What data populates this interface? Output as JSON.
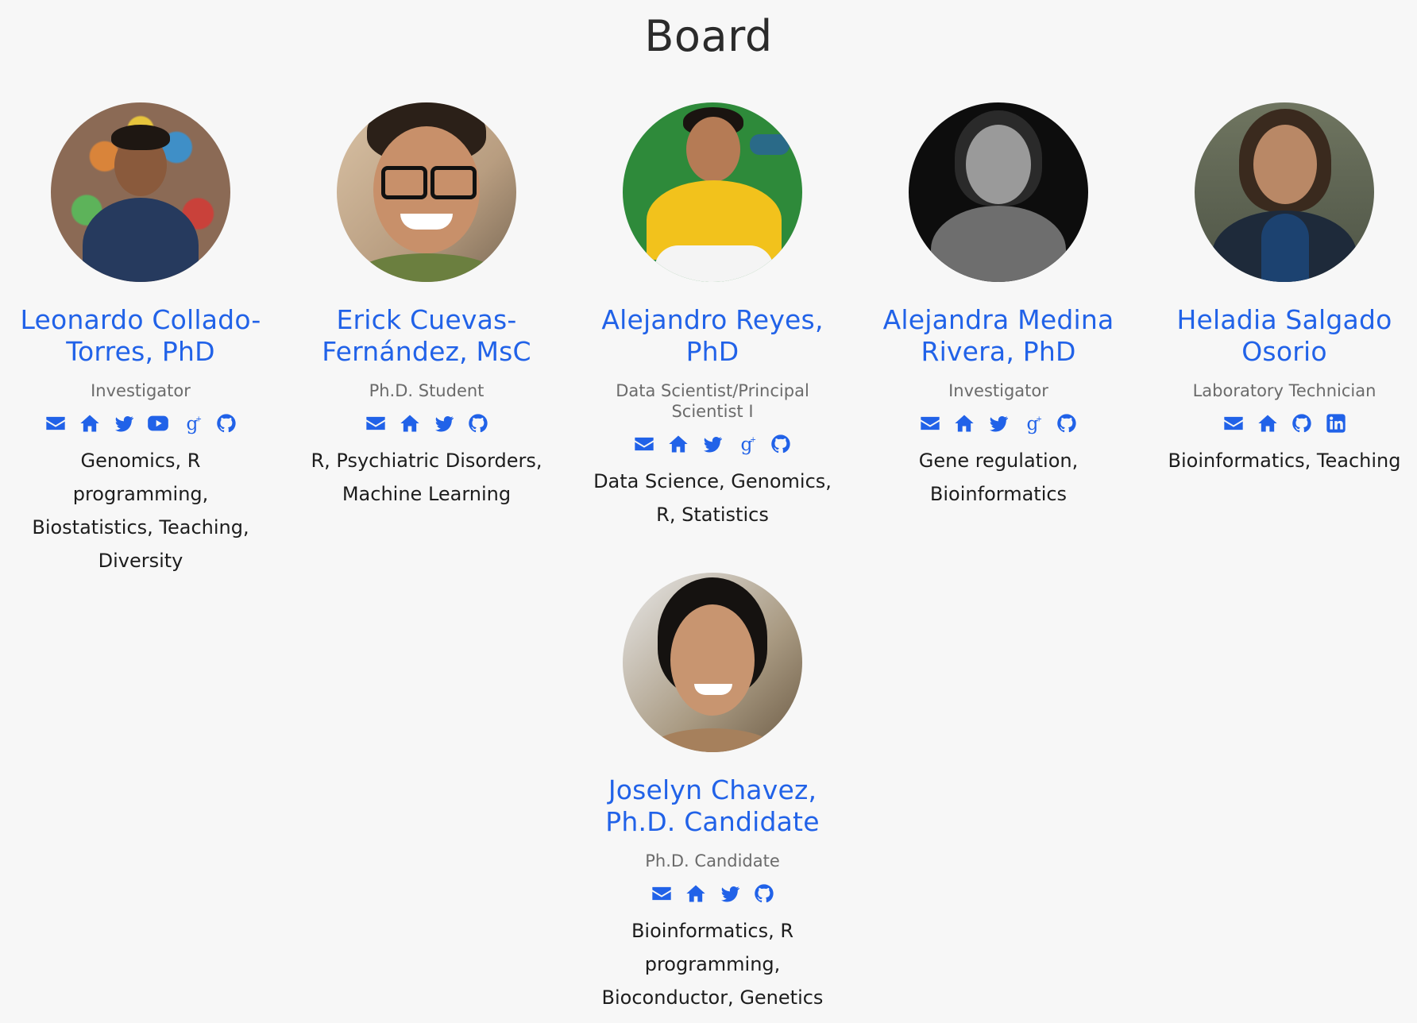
{
  "page": {
    "title": "Board"
  },
  "members": [
    {
      "name_line1": "Leonardo Collado-",
      "name_line2": "Torres, PhD",
      "role": "Investigator",
      "icons": [
        "email-icon",
        "home-icon",
        "twitter-icon",
        "youtube-icon",
        "google-scholar-icon",
        "github-icon"
      ],
      "interests": "Genomics, R programming, Biostatistics, Teaching, Diversity"
    },
    {
      "name_line1": "Erick Cuevas-",
      "name_line2": "Fernández, MsC",
      "role": "Ph.D. Student",
      "icons": [
        "email-icon",
        "home-icon",
        "twitter-icon",
        "github-icon"
      ],
      "interests": "R, Psychiatric Disorders, Machine Learning"
    },
    {
      "name_line1": "Alejandro Reyes,",
      "name_line2": "PhD",
      "role": "Data Scientist/Principal Scientist I",
      "icons": [
        "email-icon",
        "home-icon",
        "twitter-icon",
        "google-scholar-icon",
        "github-icon"
      ],
      "interests": "Data Science, Genomics, R, Statistics"
    },
    {
      "name_line1": "Alejandra Medina",
      "name_line2": "Rivera, PhD",
      "role": "Investigator",
      "icons": [
        "email-icon",
        "home-icon",
        "twitter-icon",
        "google-scholar-icon",
        "github-icon"
      ],
      "interests": "Gene regulation, Bioinformatics"
    },
    {
      "name_line1": "Heladia Salgado",
      "name_line2": "Osorio",
      "role": "Laboratory Technician",
      "icons": [
        "email-icon",
        "home-icon",
        "github-icon",
        "linkedin-icon"
      ],
      "interests": "Bioinformatics, Teaching"
    },
    {
      "name_line1": "Joselyn Chavez,",
      "name_line2": "Ph.D. Candidate",
      "role": "Ph.D. Candidate",
      "icons": [
        "email-icon",
        "home-icon",
        "twitter-icon",
        "github-icon"
      ],
      "interests": "Bioinformatics, R programming, Bioconductor, Genetics"
    }
  ],
  "colors": {
    "accent": "#2162e8",
    "background": "#f7f7f7",
    "role_text": "#6b6b6b"
  }
}
